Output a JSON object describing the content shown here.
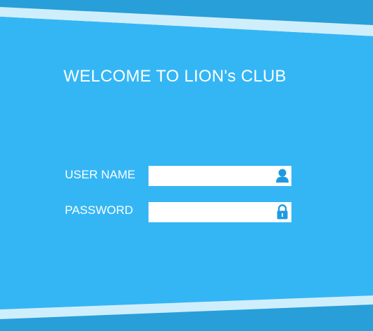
{
  "login": {
    "title": "WELCOME TO LION's CLUB",
    "username_label": "USER NAME",
    "username_value": "",
    "password_label": "PASSWORD",
    "password_value": "",
    "username_icon": "user-icon",
    "password_icon": "lock-icon"
  },
  "colors": {
    "panel_background": "#34b6f5",
    "page_background": "#289fd9",
    "stripe": "#cfeefb",
    "icon": "#1e9be0"
  }
}
